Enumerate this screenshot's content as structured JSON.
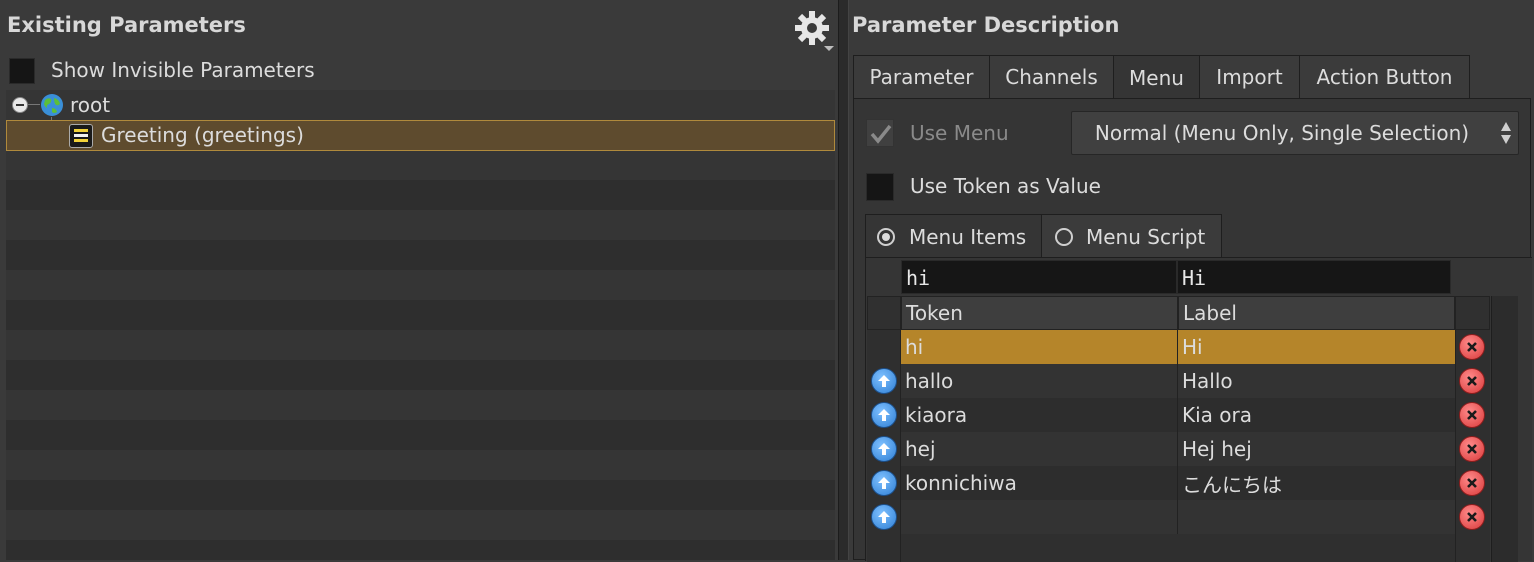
{
  "left_panel": {
    "title": "Existing Parameters",
    "show_invisible_label": "Show Invisible Parameters",
    "tree": {
      "root_label": "root",
      "child_label": "Greeting (greetings)"
    }
  },
  "right_panel": {
    "title": "Parameter Description",
    "tabs": [
      "Parameter",
      "Channels",
      "Menu",
      "Import",
      "Action Button"
    ],
    "active_tab": "Menu",
    "use_menu_label": "Use Menu",
    "menu_type_value": "Normal (Menu Only, Single Selection)",
    "use_token_label": "Use Token as Value",
    "source_tabs": {
      "menu_items_label": "Menu Items",
      "menu_script_label": "Menu Script"
    },
    "edit_token_value": "hi",
    "edit_label_value": "Hi",
    "table": {
      "headers": {
        "token": "Token",
        "label": "Label"
      },
      "rows": [
        {
          "token": "hi",
          "label": "Hi",
          "selected": true
        },
        {
          "token": "hallo",
          "label": "Hallo"
        },
        {
          "token": "kiaora",
          "label": "Kia ora"
        },
        {
          "token": "hej",
          "label": "Hej hej"
        },
        {
          "token": "konnichiwa",
          "label": "こんにちは"
        },
        {
          "token": "",
          "label": ""
        }
      ]
    }
  },
  "colors": {
    "background": "#3a3a3a",
    "selection_tree": "#5e4b2e",
    "selection_row": "#b5852a",
    "move_up": "#2f7fd4",
    "delete": "#d93a3a"
  },
  "icons": [
    "gear-icon",
    "collapse-icon",
    "globe-icon",
    "parameter-icon",
    "checkmark-icon",
    "arrow-up-icon",
    "delete-icon",
    "updown-arrows-icon"
  ]
}
